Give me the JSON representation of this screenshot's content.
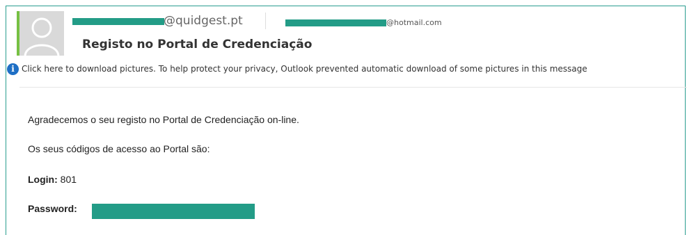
{
  "header": {
    "from_domain": "@quidgest.pt",
    "to_domain": "@hotmail.com",
    "subject": "Registo no Portal de Credenciação"
  },
  "infobar": {
    "icon": "info-icon",
    "text": "Click here to download pictures. To help protect your privacy, Outlook prevented automatic download of some pictures in this message"
  },
  "body": {
    "line1": "Agradecemos o seu registo no Portal de Credenciação on-line.",
    "line2": "Os seus códigos de acesso ao Portal são:",
    "login_label": "Login:",
    "login_value": " 801",
    "password_label": "Password:"
  },
  "colors": {
    "accent": "#2a9d8f",
    "redaction": "#239c87",
    "presence": "#76c043"
  }
}
